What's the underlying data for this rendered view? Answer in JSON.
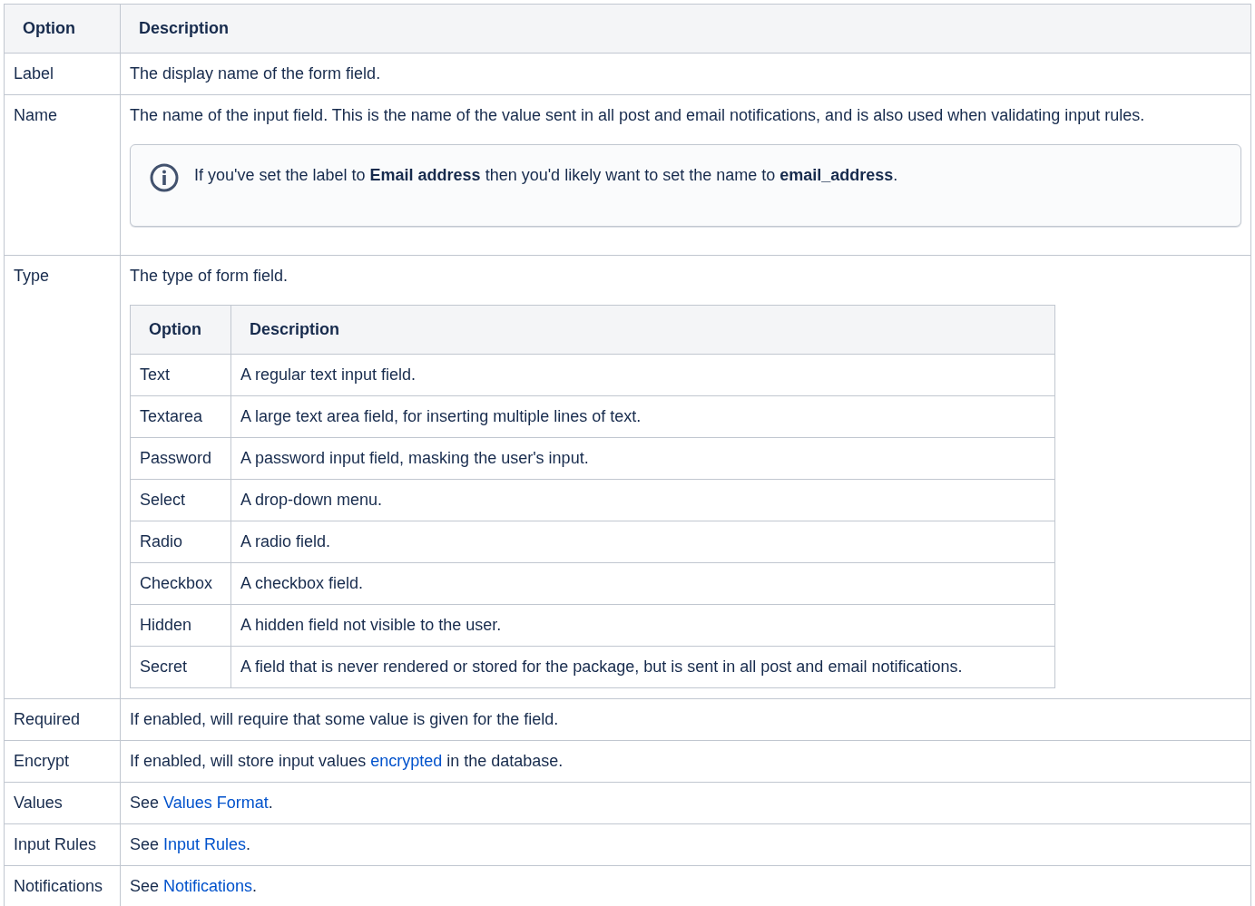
{
  "table": {
    "columns": [
      "Option",
      "Description"
    ],
    "rows": [
      {
        "option": "Label",
        "description": [
          {
            "kind": "text",
            "text": "The display name of the form field."
          }
        ]
      },
      {
        "option": "Name",
        "description": [
          {
            "kind": "text",
            "text": "The name of the input field. This is the name of the value sent in all post and email notifications, and is also used when validating input rules."
          }
        ],
        "note": {
          "text": "If you've set the label to **Email address** then you'd likely want to set the name to **email_address**."
        }
      },
      {
        "option": "Type",
        "description": [
          {
            "kind": "text",
            "text": "The type of form field."
          }
        ],
        "subtable": {
          "columns": [
            "Option",
            "Description"
          ],
          "rows": [
            {
              "option": "Text",
              "description": "A regular text input field."
            },
            {
              "option": "Textarea",
              "description": "A large text area field, for inserting multiple lines of text."
            },
            {
              "option": "Password",
              "description": "A password input field, masking the user's input."
            },
            {
              "option": "Select",
              "description": "A drop-down menu."
            },
            {
              "option": "Radio",
              "description": "A radio field."
            },
            {
              "option": "Checkbox",
              "description": "A checkbox field."
            },
            {
              "option": "Hidden",
              "description": "A hidden field not visible to the user."
            },
            {
              "option": "Secret",
              "description": "A field that is never rendered or stored for the package, but is sent in all post and email notifications."
            }
          ]
        }
      },
      {
        "option": "Required",
        "description": [
          {
            "kind": "text",
            "text": "If enabled, will require that some value is given for the field."
          }
        ]
      },
      {
        "option": "Encrypt",
        "description": [
          {
            "kind": "text",
            "text": "If enabled, will store input values "
          },
          {
            "kind": "link",
            "text": "encrypted"
          },
          {
            "kind": "text",
            "text": " in the database."
          }
        ]
      },
      {
        "option": "Values",
        "description": [
          {
            "kind": "text",
            "text": "See "
          },
          {
            "kind": "link",
            "text": "Values Format"
          },
          {
            "kind": "text",
            "text": "."
          }
        ]
      },
      {
        "option": "Input Rules",
        "description": [
          {
            "kind": "text",
            "text": "See "
          },
          {
            "kind": "link",
            "text": "Input Rules"
          },
          {
            "kind": "text",
            "text": "."
          }
        ]
      },
      {
        "option": "Notifications",
        "description": [
          {
            "kind": "text",
            "text": "See "
          },
          {
            "kind": "link",
            "text": "Notifications"
          },
          {
            "kind": "text",
            "text": "."
          }
        ]
      }
    ]
  }
}
